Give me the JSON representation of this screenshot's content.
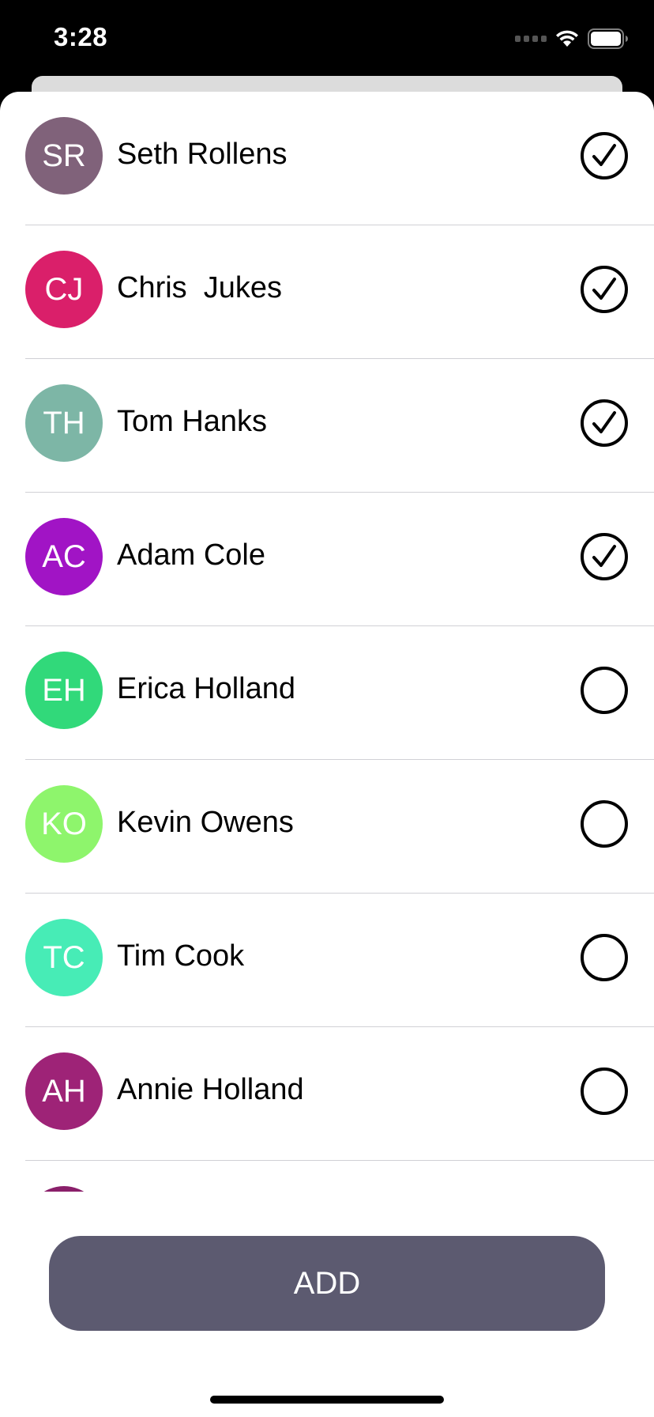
{
  "status_bar": {
    "time": "3:28"
  },
  "contacts": [
    {
      "initials": "SR",
      "name": "Seth Rollens",
      "color": "#80627a",
      "selected": true
    },
    {
      "initials": "CJ",
      "name": "Chris  Jukes",
      "color": "#da1f6a",
      "selected": true
    },
    {
      "initials": "TH",
      "name": "Tom Hanks",
      "color": "#7db6a6",
      "selected": true
    },
    {
      "initials": "AC",
      "name": "Adam Cole",
      "color": "#a114c5",
      "selected": true
    },
    {
      "initials": "EH",
      "name": "Erica Holland",
      "color": "#31d97a",
      "selected": false
    },
    {
      "initials": "KO",
      "name": "Kevin Owens",
      "color": "#8ef56c",
      "selected": false
    },
    {
      "initials": "TC",
      "name": "Tim Cook",
      "color": "#47ecb6",
      "selected": false
    },
    {
      "initials": "AH",
      "name": "Annie Holland",
      "color": "#9e2377",
      "selected": false
    },
    {
      "initials": "",
      "name": "",
      "color": "#8a1f6a",
      "selected": false
    }
  ],
  "add_button": {
    "label": "ADD"
  },
  "icons": {
    "checked": "checkmark-circle-icon",
    "unchecked": "empty-circle-icon",
    "wifi": "wifi-icon",
    "battery": "battery-icon",
    "signal": "cellular-signal-icon"
  }
}
